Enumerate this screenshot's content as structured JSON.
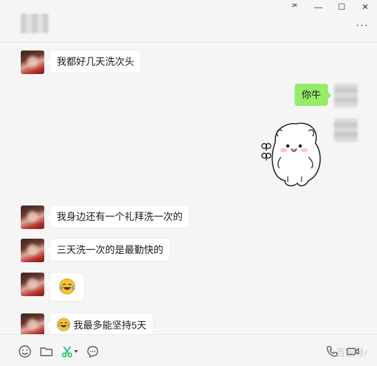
{
  "window": {
    "controls": {
      "pin": "ᅎ",
      "minimize": "—",
      "maximize": "☐",
      "close": "✕"
    },
    "more": "···"
  },
  "messages": [
    {
      "side": "left",
      "text": "我都好几天洗次头"
    },
    {
      "side": "right",
      "text": "你牛"
    },
    {
      "side": "right",
      "type": "sticker",
      "icon": "bunny-sticker"
    },
    {
      "side": "left",
      "text": "我身边还有一个礼拜洗一次的"
    },
    {
      "side": "left",
      "text": "三天洗一次的是最勤快的"
    },
    {
      "side": "left",
      "type": "emoji",
      "icon": "laugh-cry-emoji"
    },
    {
      "side": "left",
      "text": "我最多能坚持5天",
      "icon": "laugh-cry-emoji"
    }
  ],
  "toolbar": {
    "icons": [
      "emoji-icon",
      "folder-icon",
      "scissors-icon",
      "chat-bubble-icon",
      "phone-icon",
      "video-icon"
    ],
    "accent": "#07c160"
  },
  "watermark": "百家号/"
}
